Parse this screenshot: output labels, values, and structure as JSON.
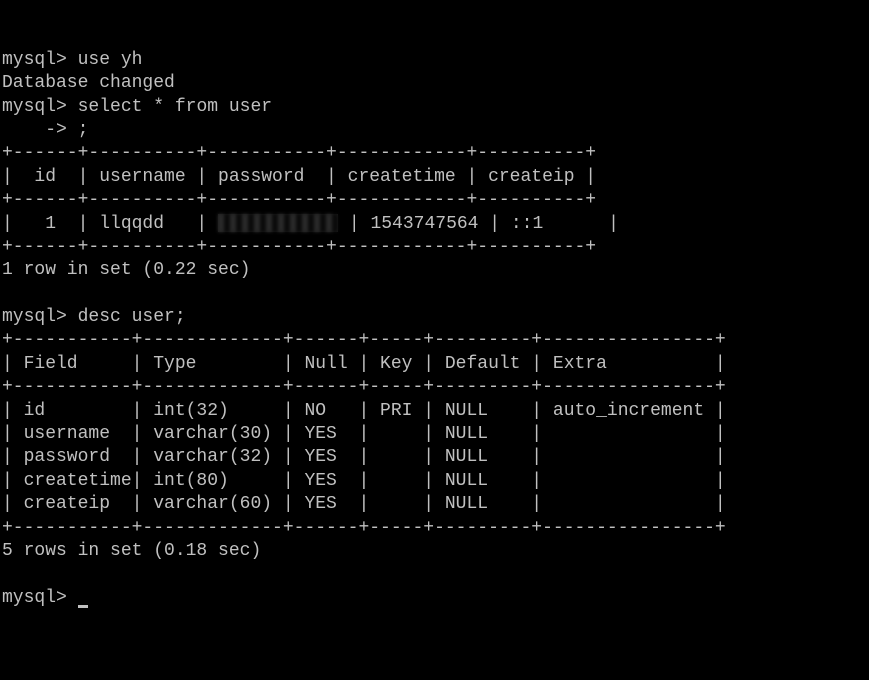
{
  "prompt": "mysql>",
  "continuation": "    ->",
  "cmd_use": "use yh",
  "msg_db_changed": "Database changed",
  "cmd_select": "select * from user",
  "semicolon": ";",
  "table1": {
    "border_top": "+------+----------+-----------+------------+----------+",
    "header_row": "|  id  | username | password  | createtime | createip |",
    "sep": "+------+----------+-----------+------------+----------+",
    "data_row_pre": "|   1  | llqqdd   | ",
    "data_row_post": " | 1543747564 | ::1      |",
    "border_bottom": "+------+----------+-----------+------------+----------+",
    "cols": {
      "id": "id",
      "username": "username",
      "password": "password",
      "createtime": "createtime",
      "createip": "createip"
    },
    "row": {
      "id": "1",
      "username": "llqqdd",
      "password": "[redacted]",
      "createtime": "1543747564",
      "createip": "::1"
    }
  },
  "msg_rows1": "1 row in set (0.22 sec)",
  "cmd_desc": "desc user;",
  "table2": {
    "border_top": "+-----------+-------------+------+-----+---------+----------------+",
    "header_row": "| Field     | Type        | Null | Key | Default | Extra          |",
    "sep": "+-----------+-------------+------+-----+---------+----------------+",
    "rows": [
      "| id        | int(32)     | NO   | PRI | NULL    | auto_increment |",
      "| username  | varchar(30) | YES  |     | NULL    |                |",
      "| password  | varchar(32) | YES  |     | NULL    |                |",
      "| createtime| int(80)     | YES  |     | NULL    |                |",
      "| createip  | varchar(60) | YES  |     | NULL    |                |"
    ],
    "border_bottom": "+-----------+-------------+------+-----+---------+----------------+",
    "headers": {
      "field": "Field",
      "type": "Type",
      "null": "Null",
      "key": "Key",
      "default": "Default",
      "extra": "Extra"
    },
    "data": [
      {
        "field": "id",
        "type": "int(32)",
        "null": "NO",
        "key": "PRI",
        "default": "NULL",
        "extra": "auto_increment"
      },
      {
        "field": "username",
        "type": "varchar(30)",
        "null": "YES",
        "key": "",
        "default": "NULL",
        "extra": ""
      },
      {
        "field": "password",
        "type": "varchar(32)",
        "null": "YES",
        "key": "",
        "default": "NULL",
        "extra": ""
      },
      {
        "field": "createtime",
        "type": "int(80)",
        "null": "YES",
        "key": "",
        "default": "NULL",
        "extra": ""
      },
      {
        "field": "createip",
        "type": "varchar(60)",
        "null": "YES",
        "key": "",
        "default": "NULL",
        "extra": ""
      }
    ]
  },
  "msg_rows2": "5 rows in set (0.18 sec)"
}
